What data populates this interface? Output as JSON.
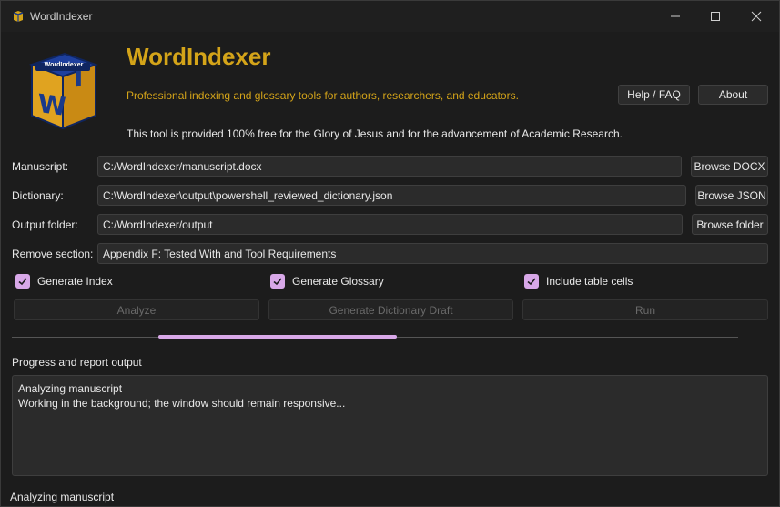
{
  "window": {
    "title": "WordIndexer",
    "controls": {
      "minimize": "minimize-icon",
      "maximize": "maximize-icon",
      "close": "close-icon"
    }
  },
  "header": {
    "logo_text": "WordIndexer",
    "logo_letters": "W I",
    "app_title": "WordIndexer",
    "tagline": "Professional indexing and glossary tools for authors, researchers, and educators.",
    "notice": "This tool is provided 100% free for the Glory of Jesus and for the advancement of Academic Research.",
    "help_label": "Help / FAQ",
    "about_label": "About"
  },
  "form": {
    "manuscript": {
      "label": "Manuscript:",
      "value": "C:/WordIndexer/manuscript.docx",
      "button": "Browse DOCX"
    },
    "dictionary": {
      "label": "Dictionary:",
      "value": "C:\\WordIndexer\\output\\powershell_reviewed_dictionary.json",
      "button": "Browse JSON"
    },
    "output_folder": {
      "label": "Output folder:",
      "value": "C:/WordIndexer/output",
      "button": "Browse folder"
    },
    "remove_section": {
      "label": "Remove section:",
      "value": "Appendix F: Tested With and Tool Requirements"
    }
  },
  "options": {
    "generate_index": {
      "label": "Generate Index",
      "checked": true
    },
    "generate_glossary": {
      "label": "Generate Glossary",
      "checked": true
    },
    "include_table_cells": {
      "label": "Include table cells",
      "checked": true
    }
  },
  "actions": {
    "analyze": "Analyze",
    "draft": "Generate Dictionary Draft",
    "run": "Run"
  },
  "progress": {
    "mode": "busy-indeterminate"
  },
  "output": {
    "label": "Progress and report output",
    "lines": [
      "Analyzing manuscript",
      "Working in the background; the window should remain responsive..."
    ]
  },
  "status_bar": {
    "text": "Analyzing manuscript"
  },
  "colors": {
    "background": "#1c1c1c",
    "accent_gold": "#d4a419",
    "accent_purple": "#d8a8e8",
    "field_bg": "#2b2b2b"
  }
}
